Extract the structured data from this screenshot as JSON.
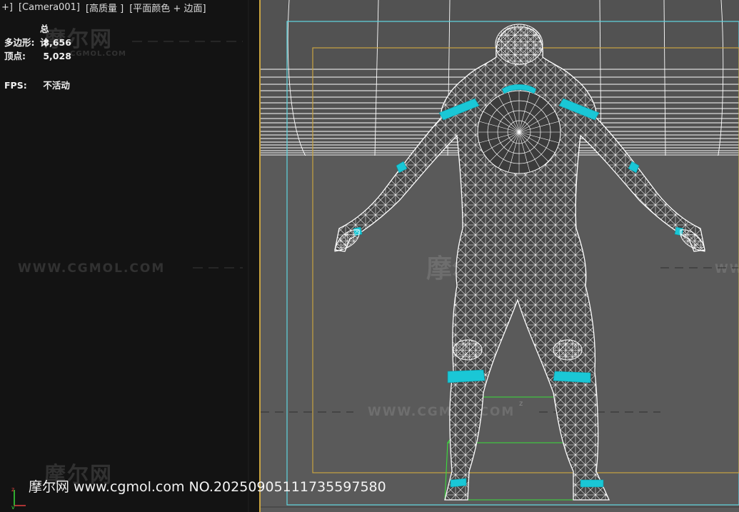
{
  "viewport": {
    "menu": {
      "plus": "+]",
      "camera": "[Camera001]",
      "quality": "[高质量 ]",
      "shading": "[平面颜色 + 边面]"
    },
    "stats": {
      "total_label": "总计",
      "polygons_label": "多边形:",
      "polygons_value": "8,656",
      "vertices_label": "顶点:",
      "vertices_value": "5,028",
      "fps_label": "FPS:",
      "fps_value": "不活动"
    }
  },
  "watermarks": {
    "logo_cn": "摩尔网",
    "site_small": "CGMOL.COM",
    "site_url_caps": "WWW.CGMOL.COM"
  },
  "credit": {
    "text": "摩尔网 www.cgmol.com NO.20250905111735597580"
  },
  "colors": {
    "background_left": "#131313",
    "viewport_gray": "#575757",
    "divider_yellow": "#c9a441",
    "frame_cyan": "#5fd6e0",
    "safe_frame_yellow": "#c9a441",
    "accent_cyan": "#1ac7d6",
    "wire_white": "#ffffff",
    "grid_green": "#3adf3a"
  },
  "icons": {
    "axis_gizmo": "axis-gizmo-icon"
  }
}
